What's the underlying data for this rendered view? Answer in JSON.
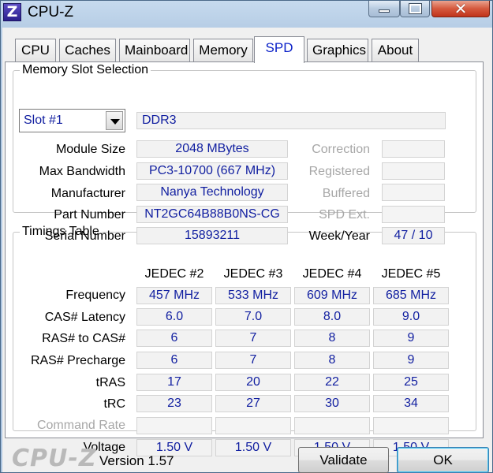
{
  "window": {
    "title": "CPU-Z",
    "app_icon_letter": "Z",
    "close_glyph": "✕"
  },
  "tabs": [
    "CPU",
    "Caches",
    "Mainboard",
    "Memory",
    "SPD",
    "Graphics",
    "About"
  ],
  "active_tab": "SPD",
  "slot": {
    "legend": "Memory Slot Selection",
    "selected": "Slot #1",
    "type": "DDR3",
    "fields": [
      {
        "label": "Module Size",
        "value": "2048 MBytes"
      },
      {
        "label": "Max Bandwidth",
        "value": "PC3-10700 (667 MHz)"
      },
      {
        "label": "Manufacturer",
        "value": "Nanya Technology"
      },
      {
        "label": "Part Number",
        "value": "NT2GC64B88B0NS-CG"
      },
      {
        "label": "Serial Number",
        "value": "15893211"
      }
    ],
    "right_fields": [
      {
        "label": "Correction",
        "value": ""
      },
      {
        "label": "Registered",
        "value": ""
      },
      {
        "label": "Buffered",
        "value": ""
      },
      {
        "label": "SPD Ext.",
        "value": ""
      },
      {
        "label": "Week/Year",
        "value": "47 / 10"
      }
    ]
  },
  "timings": {
    "legend": "Timings Table",
    "columns": [
      "JEDEC #2",
      "JEDEC #3",
      "JEDEC #4",
      "JEDEC #5"
    ],
    "rows": [
      {
        "label": "Frequency",
        "values": [
          "457 MHz",
          "533 MHz",
          "609 MHz",
          "685 MHz"
        ]
      },
      {
        "label": "CAS# Latency",
        "values": [
          "6.0",
          "7.0",
          "8.0",
          "9.0"
        ]
      },
      {
        "label": "RAS# to CAS#",
        "values": [
          "6",
          "7",
          "8",
          "9"
        ]
      },
      {
        "label": "RAS# Precharge",
        "values": [
          "6",
          "7",
          "8",
          "9"
        ]
      },
      {
        "label": "tRAS",
        "values": [
          "17",
          "20",
          "22",
          "25"
        ]
      },
      {
        "label": "tRC",
        "values": [
          "23",
          "27",
          "30",
          "34"
        ]
      },
      {
        "label": "Command Rate",
        "values": [
          "",
          "",
          "",
          ""
        ]
      },
      {
        "label": "Voltage",
        "values": [
          "1.50 V",
          "1.50 V",
          "1.50 V",
          "1.50 V"
        ]
      }
    ]
  },
  "footer": {
    "brand": "CPU-Z",
    "version": "Version 1.57",
    "validate_label": "Validate",
    "ok_label": "OK"
  },
  "colors": {
    "value_text": "#101ea0",
    "disabled_text": "#a7a7a7",
    "active_tab_text": "#0b21c8"
  }
}
